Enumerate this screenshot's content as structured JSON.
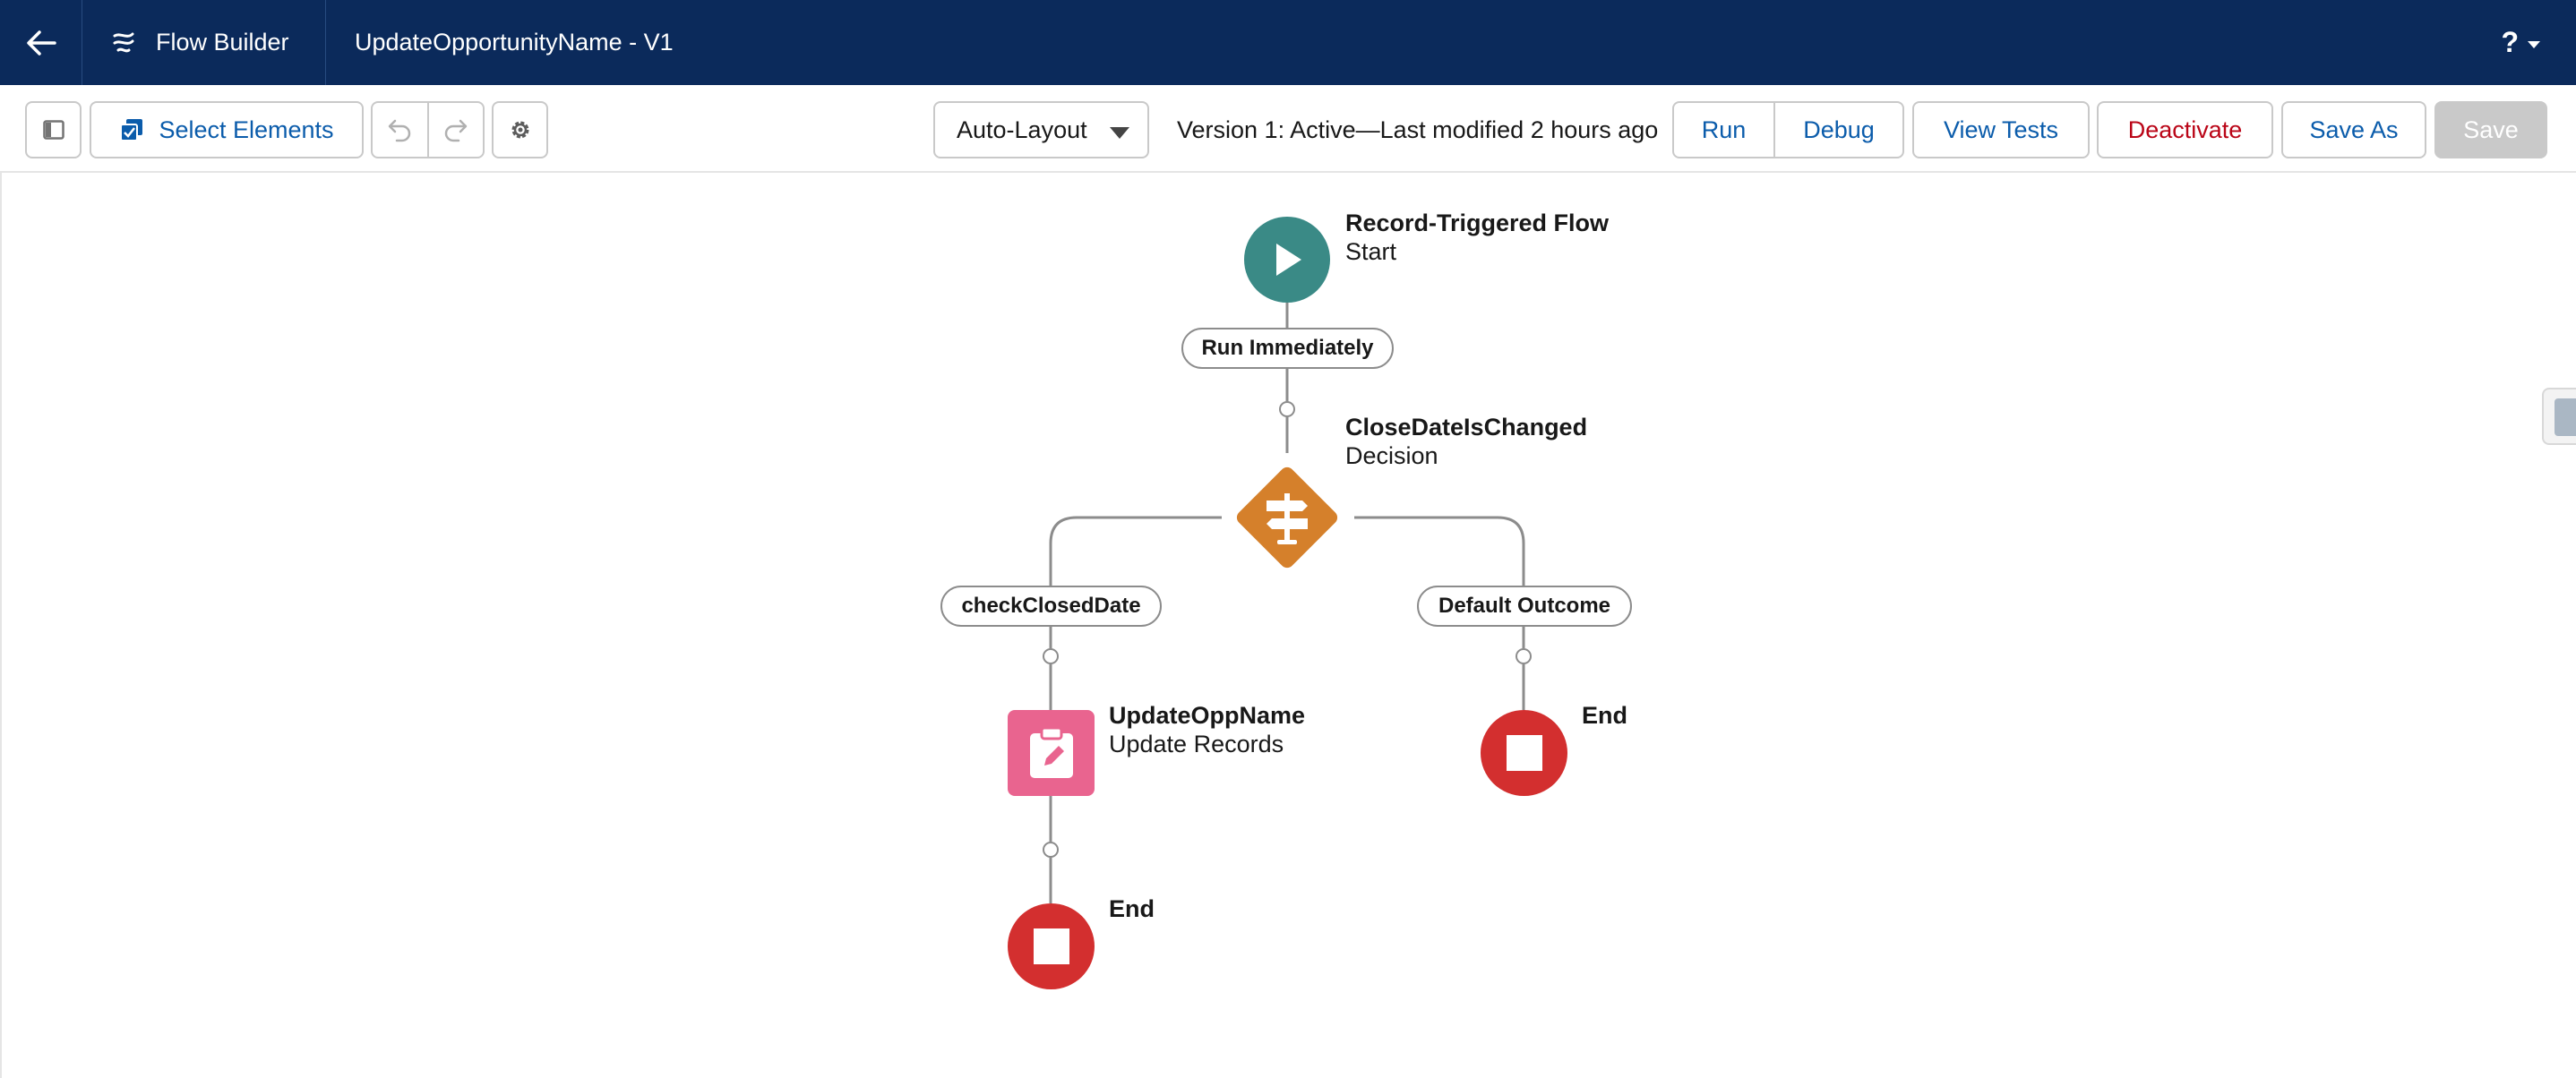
{
  "header": {
    "back_icon": "arrow-left-icon",
    "app_icon": "flow-icon",
    "app_name": "Flow Builder",
    "flow_title": "UpdateOpportunityName - V1",
    "help_label": "?",
    "colors": {
      "background": "#0b2a5b"
    }
  },
  "toolbar": {
    "toggle_panel_icon": "panel-toggle-icon",
    "select_elements_label": "Select Elements",
    "undo_icon": "undo-icon",
    "redo_icon": "redo-icon",
    "settings_icon": "gear-icon",
    "layout_selected": "Auto-Layout",
    "version_text": "Version 1: Active—Last modified 2 hours ago",
    "run_label": "Run",
    "debug_label": "Debug",
    "view_tests_label": "View Tests",
    "deactivate_label": "Deactivate",
    "save_as_label": "Save As",
    "save_label": "Save"
  },
  "canvas": {
    "start": {
      "title": "Record-Triggered Flow",
      "subtitle": "Start",
      "icon": "play-icon",
      "color": "#3a8a86"
    },
    "run_immediately": "Run Immediately",
    "decision": {
      "title": "CloseDateIsChanged",
      "subtitle": "Decision",
      "icon": "signpost-icon",
      "color": "#d5802b"
    },
    "outcome_left": "checkClosedDate",
    "outcome_right": "Default Outcome",
    "update": {
      "title": "UpdateOppName",
      "subtitle": "Update Records",
      "icon": "clipboard-edit-icon",
      "color": "#e9648f"
    },
    "end_left": {
      "title": "End",
      "icon": "stop-icon",
      "color": "#d32f2f"
    },
    "end_right": {
      "title": "End",
      "icon": "stop-icon",
      "color": "#d32f2f"
    }
  }
}
